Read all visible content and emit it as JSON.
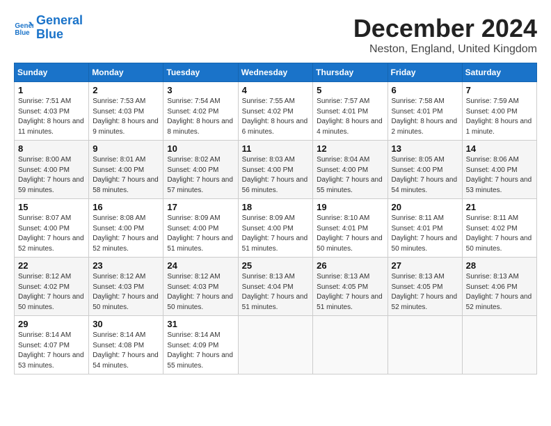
{
  "logo": {
    "line1": "General",
    "line2": "Blue"
  },
  "title": "December 2024",
  "subtitle": "Neston, England, United Kingdom",
  "days_header": [
    "Sunday",
    "Monday",
    "Tuesday",
    "Wednesday",
    "Thursday",
    "Friday",
    "Saturday"
  ],
  "weeks": [
    [
      {
        "day": "1",
        "sunrise": "7:51 AM",
        "sunset": "4:03 PM",
        "daylight": "8 hours and 11 minutes."
      },
      {
        "day": "2",
        "sunrise": "7:53 AM",
        "sunset": "4:03 PM",
        "daylight": "8 hours and 9 minutes."
      },
      {
        "day": "3",
        "sunrise": "7:54 AM",
        "sunset": "4:02 PM",
        "daylight": "8 hours and 8 minutes."
      },
      {
        "day": "4",
        "sunrise": "7:55 AM",
        "sunset": "4:02 PM",
        "daylight": "8 hours and 6 minutes."
      },
      {
        "day": "5",
        "sunrise": "7:57 AM",
        "sunset": "4:01 PM",
        "daylight": "8 hours and 4 minutes."
      },
      {
        "day": "6",
        "sunrise": "7:58 AM",
        "sunset": "4:01 PM",
        "daylight": "8 hours and 2 minutes."
      },
      {
        "day": "7",
        "sunrise": "7:59 AM",
        "sunset": "4:00 PM",
        "daylight": "8 hours and 1 minute."
      }
    ],
    [
      {
        "day": "8",
        "sunrise": "8:00 AM",
        "sunset": "4:00 PM",
        "daylight": "7 hours and 59 minutes."
      },
      {
        "day": "9",
        "sunrise": "8:01 AM",
        "sunset": "4:00 PM",
        "daylight": "7 hours and 58 minutes."
      },
      {
        "day": "10",
        "sunrise": "8:02 AM",
        "sunset": "4:00 PM",
        "daylight": "7 hours and 57 minutes."
      },
      {
        "day": "11",
        "sunrise": "8:03 AM",
        "sunset": "4:00 PM",
        "daylight": "7 hours and 56 minutes."
      },
      {
        "day": "12",
        "sunrise": "8:04 AM",
        "sunset": "4:00 PM",
        "daylight": "7 hours and 55 minutes."
      },
      {
        "day": "13",
        "sunrise": "8:05 AM",
        "sunset": "4:00 PM",
        "daylight": "7 hours and 54 minutes."
      },
      {
        "day": "14",
        "sunrise": "8:06 AM",
        "sunset": "4:00 PM",
        "daylight": "7 hours and 53 minutes."
      }
    ],
    [
      {
        "day": "15",
        "sunrise": "8:07 AM",
        "sunset": "4:00 PM",
        "daylight": "7 hours and 52 minutes."
      },
      {
        "day": "16",
        "sunrise": "8:08 AM",
        "sunset": "4:00 PM",
        "daylight": "7 hours and 52 minutes."
      },
      {
        "day": "17",
        "sunrise": "8:09 AM",
        "sunset": "4:00 PM",
        "daylight": "7 hours and 51 minutes."
      },
      {
        "day": "18",
        "sunrise": "8:09 AM",
        "sunset": "4:00 PM",
        "daylight": "7 hours and 51 minutes."
      },
      {
        "day": "19",
        "sunrise": "8:10 AM",
        "sunset": "4:01 PM",
        "daylight": "7 hours and 50 minutes."
      },
      {
        "day": "20",
        "sunrise": "8:11 AM",
        "sunset": "4:01 PM",
        "daylight": "7 hours and 50 minutes."
      },
      {
        "day": "21",
        "sunrise": "8:11 AM",
        "sunset": "4:02 PM",
        "daylight": "7 hours and 50 minutes."
      }
    ],
    [
      {
        "day": "22",
        "sunrise": "8:12 AM",
        "sunset": "4:02 PM",
        "daylight": "7 hours and 50 minutes."
      },
      {
        "day": "23",
        "sunrise": "8:12 AM",
        "sunset": "4:03 PM",
        "daylight": "7 hours and 50 minutes."
      },
      {
        "day": "24",
        "sunrise": "8:12 AM",
        "sunset": "4:03 PM",
        "daylight": "7 hours and 50 minutes."
      },
      {
        "day": "25",
        "sunrise": "8:13 AM",
        "sunset": "4:04 PM",
        "daylight": "7 hours and 51 minutes."
      },
      {
        "day": "26",
        "sunrise": "8:13 AM",
        "sunset": "4:05 PM",
        "daylight": "7 hours and 51 minutes."
      },
      {
        "day": "27",
        "sunrise": "8:13 AM",
        "sunset": "4:05 PM",
        "daylight": "7 hours and 52 minutes."
      },
      {
        "day": "28",
        "sunrise": "8:13 AM",
        "sunset": "4:06 PM",
        "daylight": "7 hours and 52 minutes."
      }
    ],
    [
      {
        "day": "29",
        "sunrise": "8:14 AM",
        "sunset": "4:07 PM",
        "daylight": "7 hours and 53 minutes."
      },
      {
        "day": "30",
        "sunrise": "8:14 AM",
        "sunset": "4:08 PM",
        "daylight": "7 hours and 54 minutes."
      },
      {
        "day": "31",
        "sunrise": "8:14 AM",
        "sunset": "4:09 PM",
        "daylight": "7 hours and 55 minutes."
      },
      null,
      null,
      null,
      null
    ]
  ],
  "labels": {
    "sunrise": "Sunrise:",
    "sunset": "Sunset:",
    "daylight": "Daylight:"
  }
}
